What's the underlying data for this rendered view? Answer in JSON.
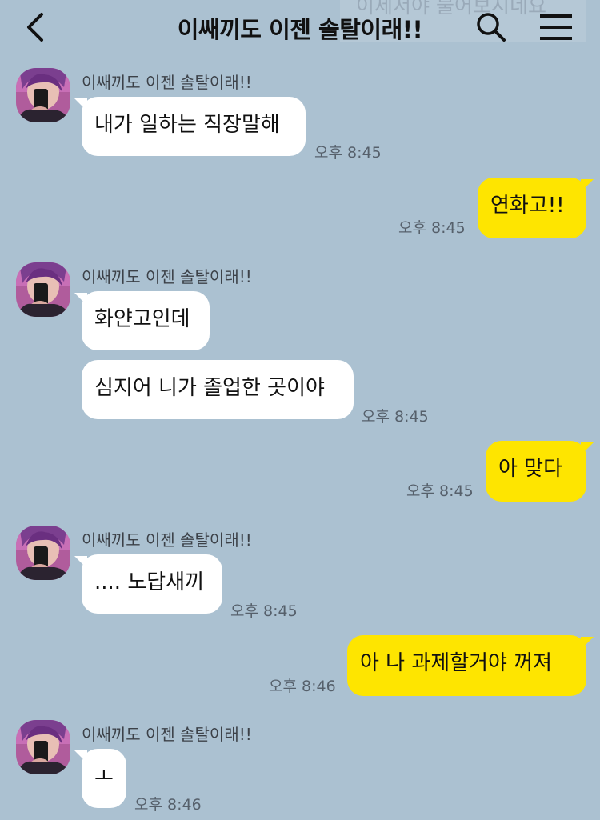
{
  "header": {
    "title": "이쌔끼도 이젠 솔탈이래!!",
    "ghost_text": "이제서야 물어보시네요"
  },
  "icons": {
    "back": "chevron-left-icon",
    "search": "search-icon",
    "menu": "hamburger-menu-icon"
  },
  "colors": {
    "background": "#abc1d1",
    "incoming_bubble": "#ffffff",
    "outgoing_bubble": "#fee500",
    "timestamp": "#56606b"
  },
  "sender_name": "이쌔끼도 이젠 솔탈이래!!",
  "messages": [
    {
      "direction": "in",
      "text": "내가 일하는 직장말해",
      "time": "오후 8:45"
    },
    {
      "direction": "out",
      "text": "연화고!!",
      "time": "오후 8:45"
    },
    {
      "direction": "in",
      "text": "화얀고인데",
      "time": ""
    },
    {
      "direction": "in",
      "text": "심지어 니가 졸업한 곳이야",
      "time": "오후 8:45"
    },
    {
      "direction": "out",
      "text": "아 맞다",
      "time": "오후 8:45"
    },
    {
      "direction": "in",
      "text": ".... 노답새끼",
      "time": "오후 8:45"
    },
    {
      "direction": "out",
      "text": "아 나 과제할거야 꺼져",
      "time": "오후 8:46"
    },
    {
      "direction": "in",
      "text": "ㅗ",
      "time": "오후 8:46"
    }
  ]
}
